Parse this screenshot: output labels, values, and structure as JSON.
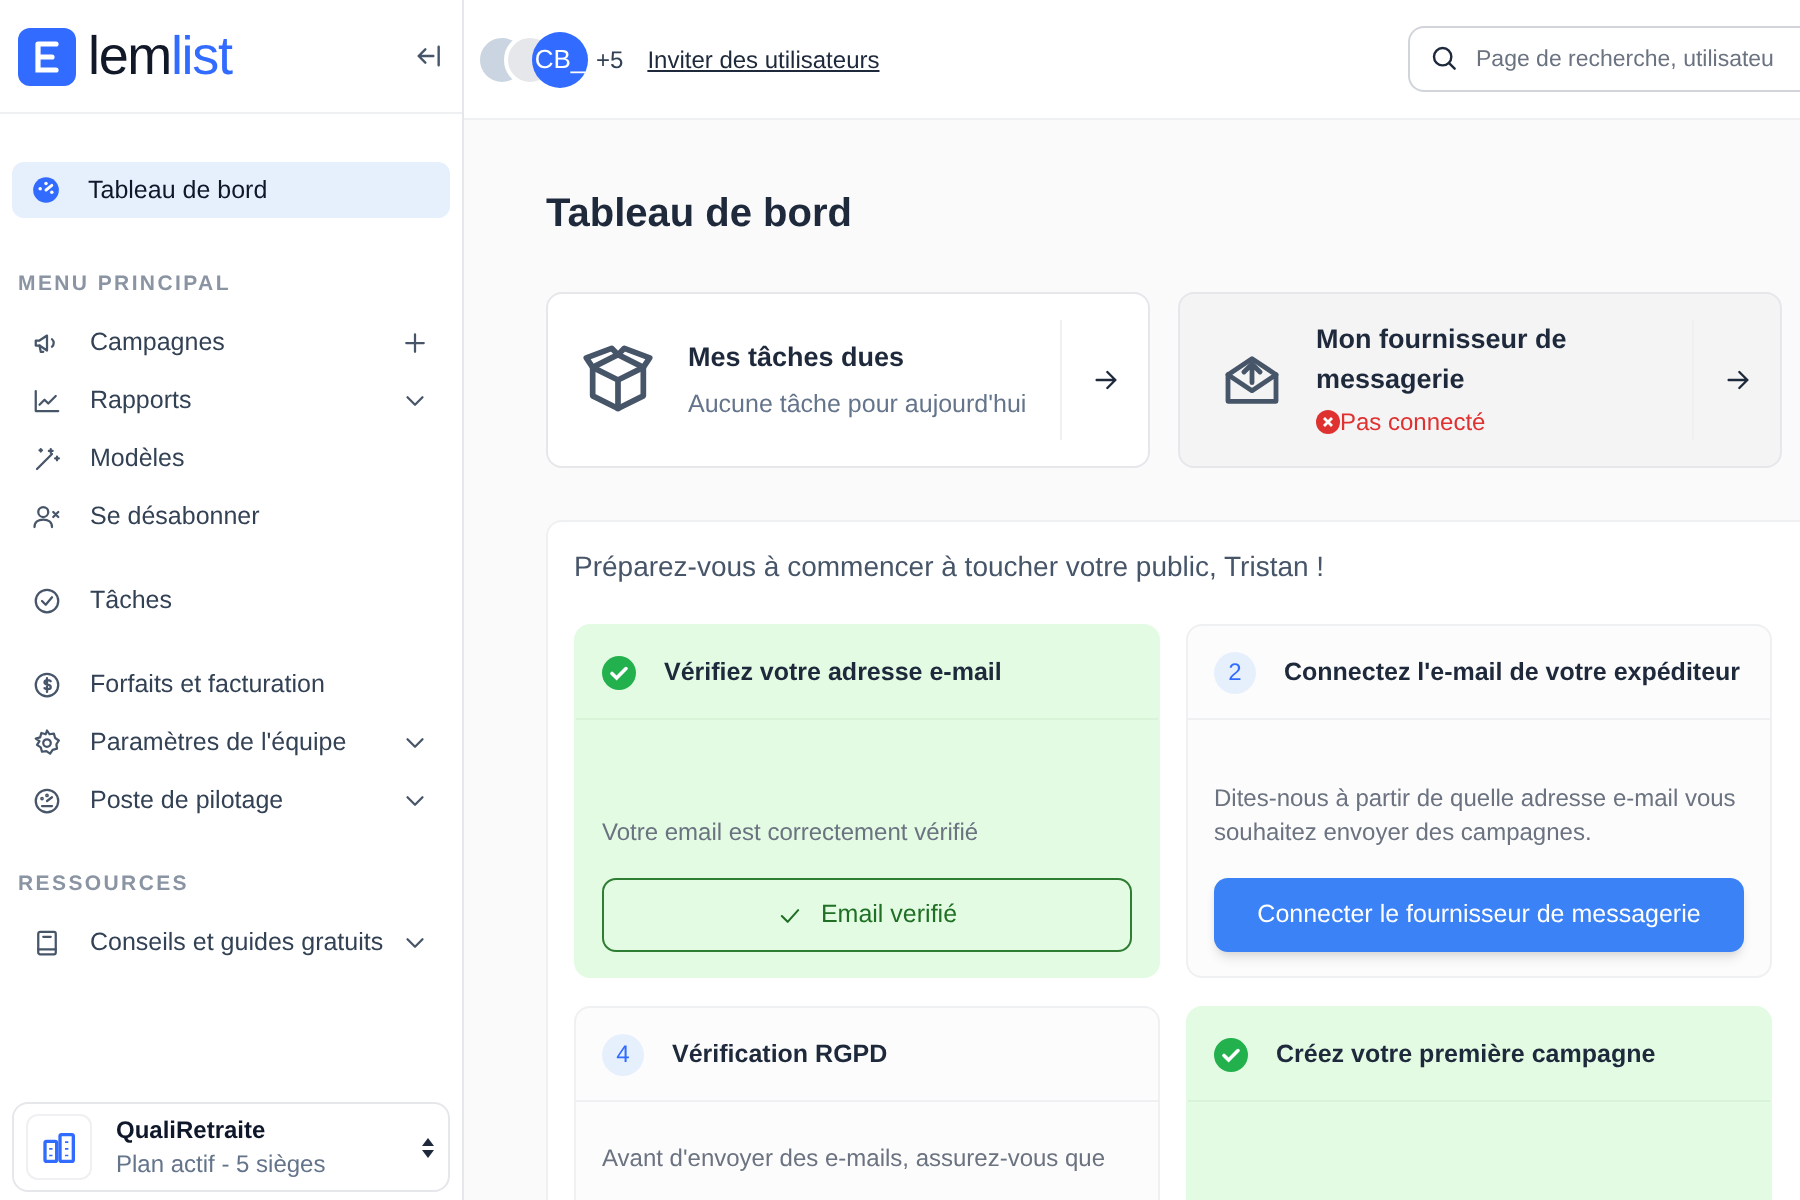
{
  "sidebar": {
    "logo": {
      "text_1": "lem",
      "text_2": "list"
    },
    "active_item": {
      "label": "Tableau de bord",
      "selected": true
    },
    "groups": [
      {
        "heading": "MENU PRINCIPAL",
        "items": [
          {
            "label": "Campagnes",
            "kind": "add"
          },
          {
            "label": "Rapports",
            "kind": "expandable"
          },
          {
            "label": "Modèles",
            "kind": "link"
          },
          {
            "label": "Se désabonner",
            "kind": "link"
          }
        ]
      },
      {
        "items": [
          {
            "label": "Tâches",
            "kind": "link"
          }
        ]
      },
      {
        "items": [
          {
            "label": "Forfaits et facturation",
            "kind": "link"
          },
          {
            "label": "Paramètres de l'équipe",
            "kind": "expandable"
          },
          {
            "label": "Poste de pilotage",
            "kind": "expandable"
          }
        ]
      },
      {
        "heading": "RESSOURCES",
        "items": [
          {
            "label": "Conseils et guides gratuits",
            "kind": "expandable"
          }
        ]
      }
    ],
    "workspace": {
      "name": "QualiRetraite",
      "plan": "Plan actif - 5 sièges"
    }
  },
  "header": {
    "avatar_initials": "CB_",
    "avatar_more": "+5",
    "invite_link": "Inviter des utilisateurs",
    "search": {
      "placeholder": "Page de recherche, utilisateu"
    }
  },
  "page": {
    "title": "Tableau de bord",
    "summary_cards": [
      {
        "title": "Mes tâches dues",
        "subtitle": "Aucune tâche pour aujourd'hui"
      },
      {
        "title": "Mon fournisseur de messagerie",
        "status": "Pas connecté",
        "connected": false
      }
    ],
    "onboarding": {
      "greeting": "Préparez-vous à commencer à toucher votre public, Tristan !",
      "steps": [
        {
          "done": true,
          "title": "Vérifiez votre adresse e-mail",
          "description": "Votre email est correctement vérifié",
          "button": "Email verifié"
        },
        {
          "done": false,
          "number": "2",
          "title": "Connectez l'e-mail de votre expéditeur",
          "description": "Dites-nous à partir de quelle adresse e-mail vous souhaitez envoyer des campagnes.",
          "button": "Connecter le fournisseur de messagerie"
        },
        {
          "done": false,
          "number": "4",
          "title": "Vérification RGPD",
          "description": "Avant d'envoyer des e-mails, assurez-vous que"
        },
        {
          "done": true,
          "title": "Créez votre première campagne"
        }
      ]
    }
  }
}
